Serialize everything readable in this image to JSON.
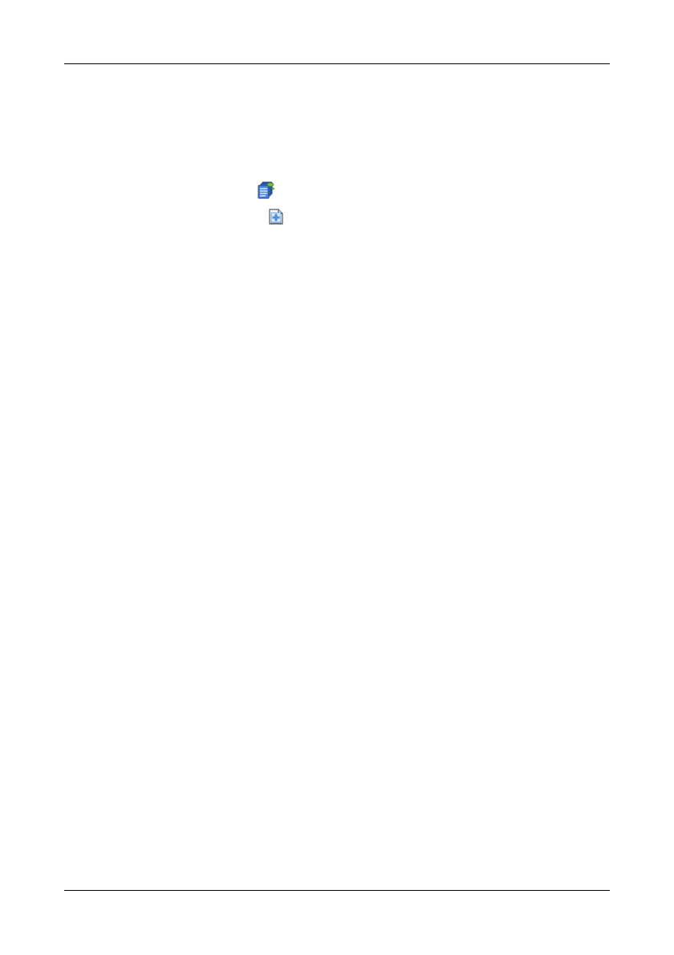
{
  "page": {
    "background": "#ffffff",
    "rule_color": "#000000"
  },
  "icons": [
    {
      "name": "logical-drive-stack-icon",
      "color": "#3a73d6"
    },
    {
      "name": "document-plus-icon",
      "color": "#4f8fd9"
    }
  ]
}
